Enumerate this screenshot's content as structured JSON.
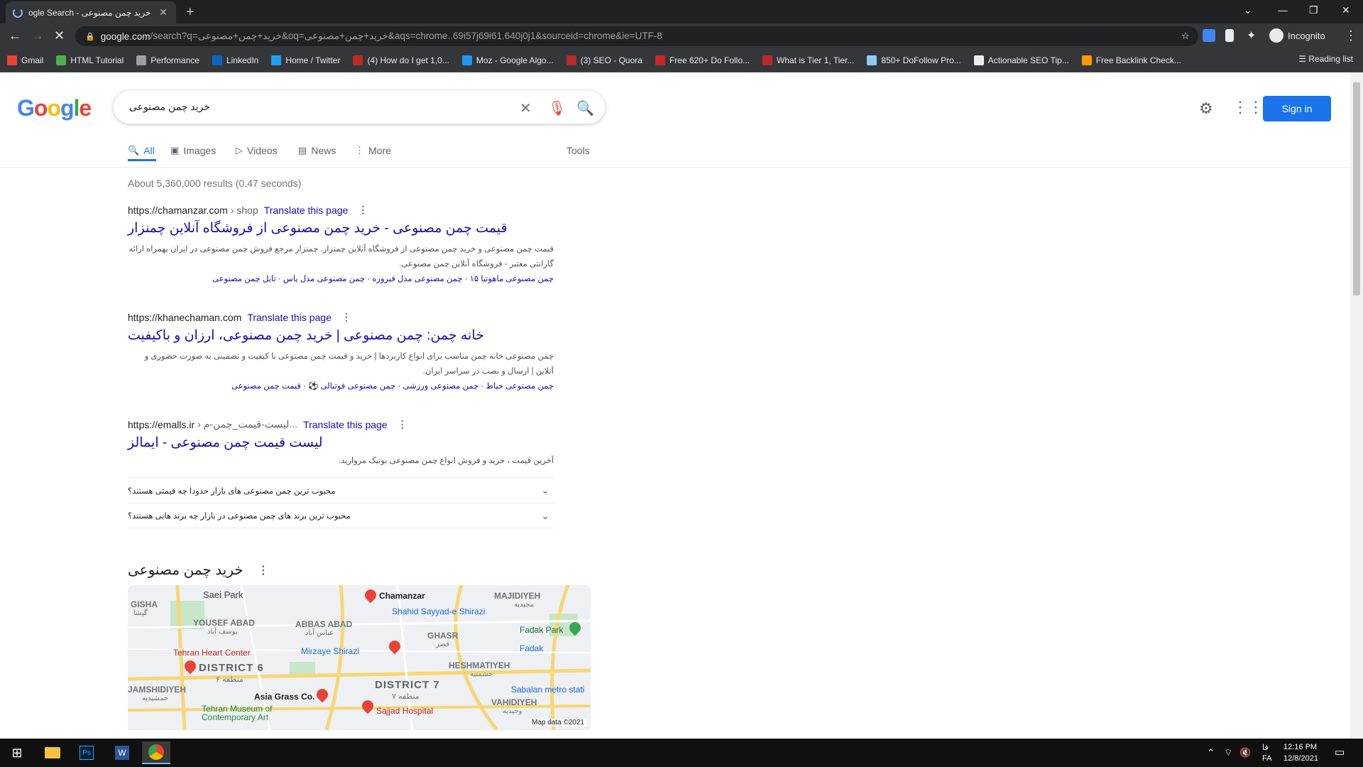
{
  "browser": {
    "tab_title": "ogle Search - خرید چمن مصنوعی",
    "url_domain": "google.com",
    "url_rest": "/search?q=خرید+چمن+مصنوعی&oq=خرید+چمن+مصنوعی&aqs=chrome..69i57j69i61.640j0j1&sourceid=chrome&ie=UTF-8",
    "profile": "Incognito",
    "bookmarks": [
      {
        "label": "Gmail",
        "color": "#ea4335"
      },
      {
        "label": "HTML Tutorial",
        "color": "#4caf50"
      },
      {
        "label": "Performance",
        "color": "#9e9e9e"
      },
      {
        "label": "LinkedIn",
        "color": "#0a66c2"
      },
      {
        "label": "Home / Twitter",
        "color": "#1da1f2"
      },
      {
        "label": "(4) How do I get 1,0...",
        "color": "#b92b27"
      },
      {
        "label": "Moz - Google Algo...",
        "color": "#2196f3"
      },
      {
        "label": "(3) SEO - Quora",
        "color": "#b92b27"
      },
      {
        "label": "Free 620+ Do Follo...",
        "color": "#c62828"
      },
      {
        "label": "What is Tier 1, Tier...",
        "color": "#b92b27"
      },
      {
        "label": "850+ DoFollow Pro...",
        "color": "#90caf9"
      },
      {
        "label": "Actionable SEO Tip...",
        "color": "#eeeeee"
      },
      {
        "label": "Free Backlink Check...",
        "color": "#ff9800"
      }
    ],
    "reading_list": "Reading list"
  },
  "search": {
    "query": "خرید چمن مصنوعی",
    "sign_in": "Sign in",
    "tabs": [
      "All",
      "Images",
      "Videos",
      "News",
      "More"
    ],
    "tools": "Tools",
    "stats": "About 5,360,000 results (0.47 seconds)"
  },
  "results": [
    {
      "url": "https://chamanzar.com",
      "breadcrumb": "› shop",
      "translate": "Translate this page",
      "title": "قیمت چمن مصنوعی - خرید چمن مصنوعی از فروشگاه آنلاین چمنزار",
      "snippet": "قیمت چمن مصنوعی و خرید چمن مصنوعی از فروشگاه آنلاین چمنزار. چمنزار مرجع فروش چمن مصنوعی در ایران بهمراه ارائه گارانتی معتبر - فروشگاه آنلاین چمن مصنوعی.",
      "sitelinks": "چمن مصنوعی ماهوتیا ۱۵ · چمن مصنوعی مدل فیروزه · چمن مصنوعی مدل یاس · تایل چمن مصنوعی"
    },
    {
      "url": "https://khanechaman.com",
      "breadcrumb": "",
      "translate": "Translate this page",
      "title": "خانه چمن: چمن مصنوعی | خرید چمن مصنوعی، ارزان و باکیفیت",
      "snippet": "چمن مصنوعی خانه چمن مناسب برای انواع کاربردها | خرید و قیمت چمن مصنوعی با کیفیت و تضمینی به صورت حضوری و آنلاین | ارسال و نصب در سراسر ایران.",
      "sitelinks": "چمن مصنوعی حیاط · چمن مصنوعی ورزشی · چمن مصنوعی فوتبالی ⚽ · قیمت چمن مصنوعی"
    },
    {
      "url": "https://emalls.ir",
      "breadcrumb": "› لیست-قیمت_چمن-م...",
      "translate": "Translate this page",
      "title": "لیست قیمت چمن مصنوعی - ایمالز",
      "snippet": "آخرین قیمت ، خرید و فروش انواع چمن مصنوعی بوتیک مروارید.",
      "sitelinks": ""
    }
  ],
  "faqs": [
    "محبوب ترین چمن مصنوعی های بازار حدودا چه قیمتی هستند؟",
    "محبوب ترین برند های چمن مصنوعی در بازار چه برند هایی هستند؟"
  ],
  "map_section": {
    "title": "خرید چمن مصنوعی",
    "labels": {
      "gisha": "GISHA",
      "gisha_fa": "گیشا",
      "saei": "Saei Park",
      "chamanzar": "Chamanzar",
      "majidiyeh": "MAJIDIYEH",
      "majidiyeh_fa": "مجیدیه",
      "yousef": "YOUSEF ABAD",
      "yousef_fa": "یوسف آباد",
      "abbas": "ABBAS ABAD",
      "abbas_fa": "عباس آباد",
      "shahid": "Shahid Sayyad-e Shirazi",
      "ghasr": "GHASR",
      "ghasr_fa": "قصر",
      "mirzaye": "Mirzaye Shirazi",
      "fadak_park": "Fadak Park",
      "fadak": "Fadak",
      "heart": "Tehran Heart Center",
      "heshmatiyeh": "HESHMATIYEH",
      "heshmatiyeh_fa": "حشمتیه",
      "district6": "DISTRICT 6",
      "district6_fa": "منطقه ۶",
      "district7": "DISTRICT 7",
      "district7_fa": "منطقه ۷",
      "jamshidiyeh": "JAMSHIDIYEH",
      "jamshidiyeh_fa": "جمشیدیه",
      "asia": "Asia Grass Co.",
      "sabalan": "Sabalan metro stati",
      "vahidiyeh": "VAHIDIYEH",
      "vahidiyeh_fa": "وحیدیه",
      "museum": "Tehran Museum of Contemporary Art",
      "sajjad": "Sajjad Hospital",
      "mapdata": "Map data ©2021"
    }
  },
  "taskbar": {
    "time": "12:16 PM",
    "date": "12/8/2021",
    "lang": "FA",
    "lang_fa": "فا"
  }
}
